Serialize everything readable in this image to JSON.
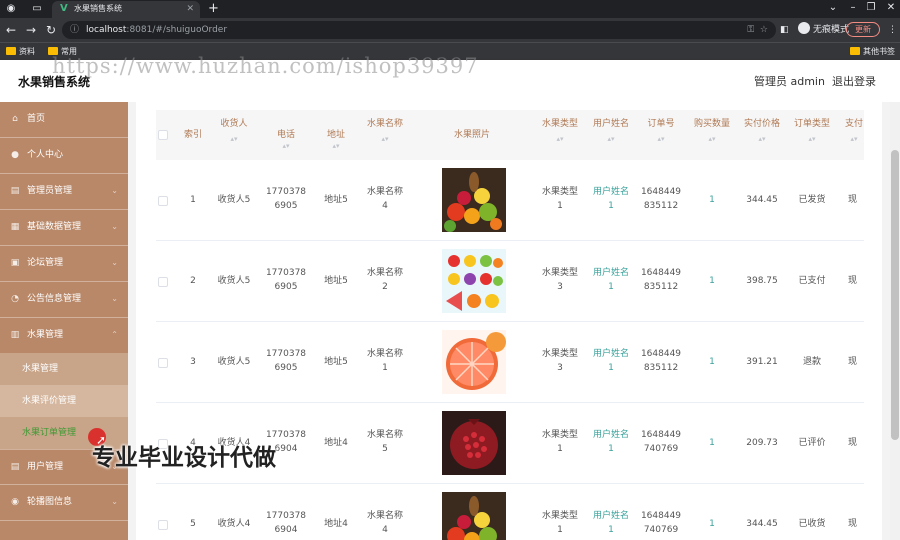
{
  "browser": {
    "tab_title": "水果销售系统",
    "url_host": "localhost",
    "url_rest": ":8081/#/shuiguoOrder",
    "incognito_label": "无痕模式",
    "update_label": "更新",
    "bookmarks": [
      "资料",
      "常用"
    ],
    "other_bookmarks": "其他书签"
  },
  "header": {
    "title": "水果销售系统",
    "user": "管理员 admin",
    "logout": "退出登录"
  },
  "watermark": "https://www.huzhan.com/ishop39397",
  "overlay_text": "专业毕业设计代做",
  "sidebar": {
    "items": [
      {
        "label": "首页",
        "icon": "home-icon"
      },
      {
        "label": "个人中心",
        "icon": "user-icon"
      },
      {
        "label": "管理员管理",
        "icon": "admin-icon"
      },
      {
        "label": "基础数据管理",
        "icon": "grid-icon"
      },
      {
        "label": "论坛管理",
        "icon": "forum-icon"
      },
      {
        "label": "公告信息管理",
        "icon": "notice-icon"
      },
      {
        "label": "水果管理",
        "icon": "fruit-icon"
      }
    ],
    "sub_items": [
      "水果管理",
      "水果评价管理",
      "水果订单管理"
    ],
    "items_after": [
      {
        "label": "用户管理",
        "icon": "users-icon"
      },
      {
        "label": "轮播图信息",
        "icon": "carousel-icon"
      }
    ]
  },
  "table": {
    "columns": [
      "索引",
      "收货人",
      "电话",
      "地址",
      "水果名称",
      "水果照片",
      "水果类型",
      "用户姓名",
      "订单号",
      "购买数量",
      "实付价格",
      "订单类型",
      "支付"
    ],
    "rows": [
      {
        "index": "1",
        "receiver": "收货人5",
        "phone_a": "1770378",
        "phone_b": "6905",
        "address": "地址5",
        "name_a": "水果名称",
        "name_b": "4",
        "type_a": "水果类型",
        "type_b": "1",
        "user_a": "用户姓名",
        "user_b": "1",
        "order_a": "1648449",
        "order_b": "835112",
        "qty": "1",
        "price": "344.45",
        "status": "已发货",
        "pay": "现"
      },
      {
        "index": "2",
        "receiver": "收货人5",
        "phone_a": "1770378",
        "phone_b": "6905",
        "address": "地址5",
        "name_a": "水果名称",
        "name_b": "2",
        "type_a": "水果类型",
        "type_b": "3",
        "user_a": "用户姓名",
        "user_b": "1",
        "order_a": "1648449",
        "order_b": "835112",
        "qty": "1",
        "price": "398.75",
        "status": "已支付",
        "pay": "现"
      },
      {
        "index": "3",
        "receiver": "收货人5",
        "phone_a": "1770378",
        "phone_b": "6905",
        "address": "地址5",
        "name_a": "水果名称",
        "name_b": "1",
        "type_a": "水果类型",
        "type_b": "3",
        "user_a": "用户姓名",
        "user_b": "1",
        "order_a": "1648449",
        "order_b": "835112",
        "qty": "1",
        "price": "391.21",
        "status": "退款",
        "pay": "现"
      },
      {
        "index": "4",
        "receiver": "收货人4",
        "phone_a": "1770378",
        "phone_b": "6904",
        "address": "地址4",
        "name_a": "水果名称",
        "name_b": "5",
        "type_a": "水果类型",
        "type_b": "1",
        "user_a": "用户姓名",
        "user_b": "1",
        "order_a": "1648449",
        "order_b": "740769",
        "qty": "1",
        "price": "209.73",
        "status": "已评价",
        "pay": "现"
      },
      {
        "index": "5",
        "receiver": "收货人4",
        "phone_a": "1770378",
        "phone_b": "6904",
        "address": "地址4",
        "name_a": "水果名称",
        "name_b": "4",
        "type_a": "水果类型",
        "type_b": "1",
        "user_a": "用户姓名",
        "user_b": "1",
        "order_a": "1648449",
        "order_b": "740769",
        "qty": "1",
        "price": "344.45",
        "status": "已收货",
        "pay": "现"
      }
    ]
  },
  "colors": {
    "sidebar": "#b98868",
    "accent": "#3aa19a",
    "active_sub": "#3f9a34",
    "header_text": "#b07a55"
  }
}
